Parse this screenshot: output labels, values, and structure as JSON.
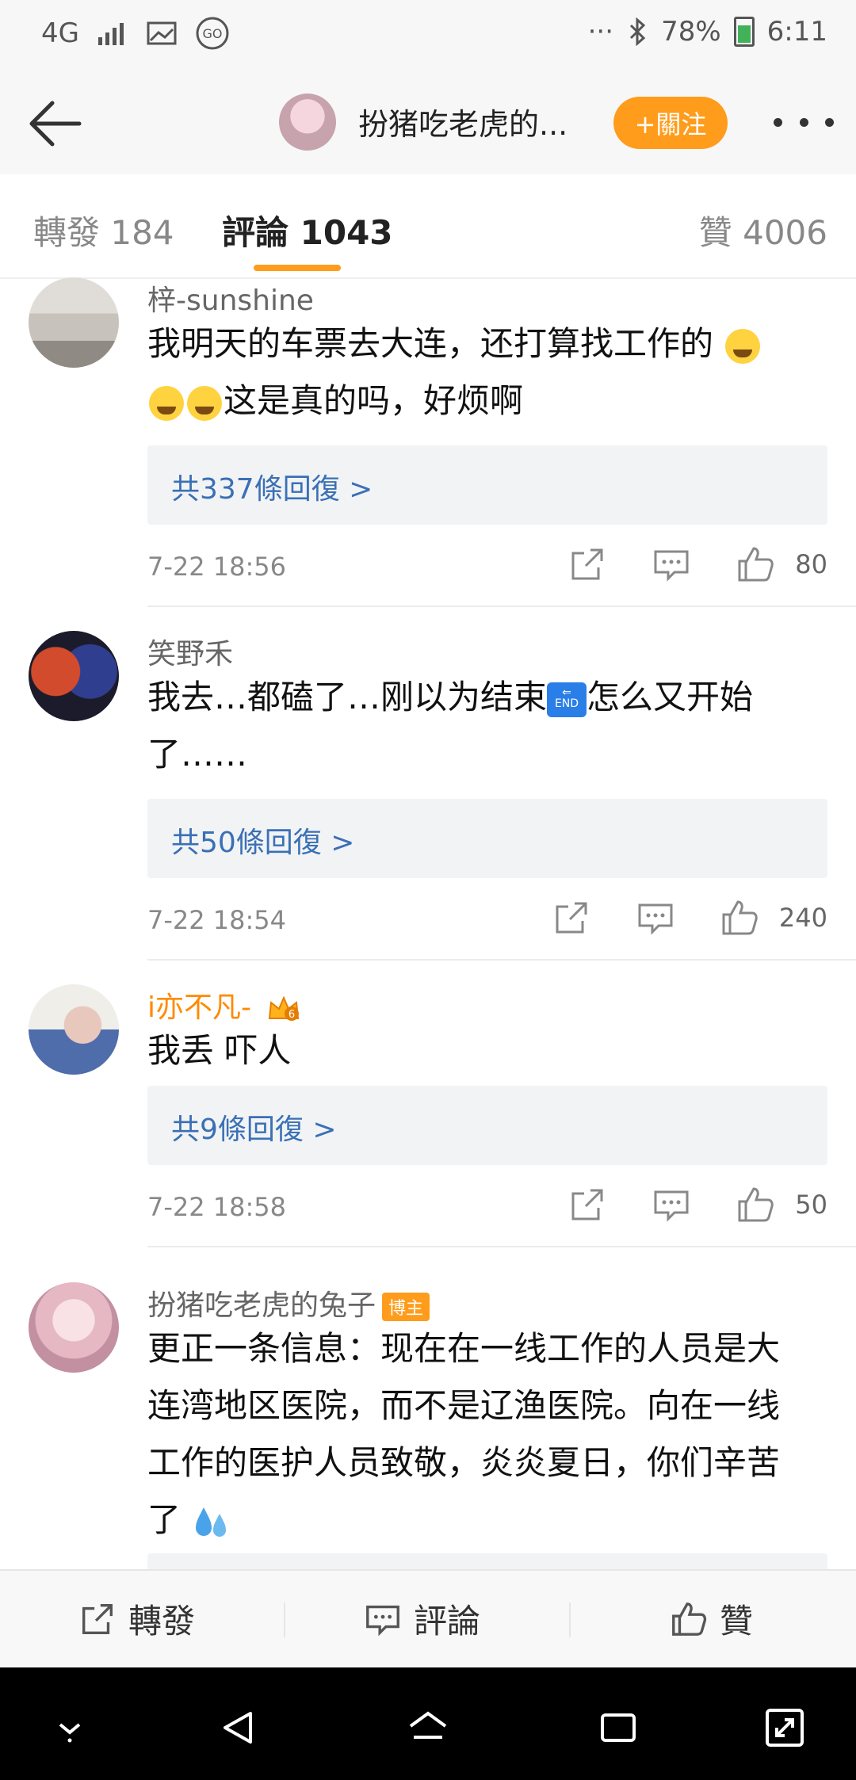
{
  "status_bar": {
    "network": "4G",
    "battery": "78%",
    "time": "6:11",
    "misc": "···"
  },
  "header": {
    "title": "扮猪吃老虎的...",
    "follow_label": "+關注"
  },
  "tabs": {
    "repost": "轉發 184",
    "comment": "評論 1043",
    "like": "贊 4006"
  },
  "comments": [
    {
      "name": "梓-sunshine",
      "text_line1": "我明天的车票去大连，还打算找工作的",
      "text_line2": "这是真的吗，好烦啊",
      "replies": "共337條回復 >",
      "time": "7-22 18:56",
      "likes": "80"
    },
    {
      "name": "笑野禾",
      "text_line1_a": "我去…都磕了…刚以为结束",
      "text_line1_b": "怎么又开始",
      "text_line2": "了……",
      "end_emoji": "END",
      "replies": "共50條回復 >",
      "time": "7-22 18:54",
      "likes": "240"
    },
    {
      "name": "i亦不凡-",
      "crown": "6",
      "text": "我丢 吓人",
      "replies": "共9條回復 >",
      "time": "7-22 18:58",
      "likes": "50"
    },
    {
      "name": "扮猪吃老虎的兔子",
      "badge": "博主",
      "text_line1": "更正一条信息：现在在一线工作的人员是大",
      "text_line2": "连湾地区医院，而不是辽渔医院。向在一线",
      "text_line3": "工作的医护人员致敬，炎炎夏日，你们辛苦",
      "text_line4": "了"
    }
  ],
  "bottom_bar": {
    "repost": "轉發",
    "comment": "評論",
    "like": "贊"
  },
  "colors": {
    "accent": "#ff9c1b",
    "link": "#3a70b5"
  }
}
